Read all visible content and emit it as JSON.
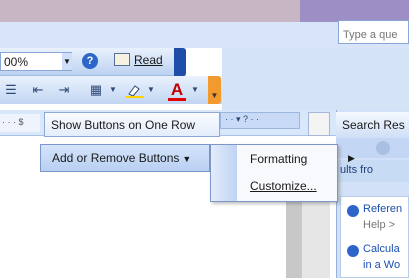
{
  "window": {
    "help_search_placeholder": "Type a que"
  },
  "standard_toolbar": {
    "zoom_value": "00%",
    "read_label": "Read"
  },
  "toolbar_options": {
    "show_buttons_one_row": "Show Buttons on One Row",
    "add_remove_buttons": "Add or Remove Buttons"
  },
  "submenu": {
    "items": [
      {
        "label": "Formatting"
      },
      {
        "label": "Customize..."
      }
    ]
  },
  "task_pane": {
    "title": "Search Res",
    "results_header": "ults fro",
    "results": [
      {
        "title": "Referen",
        "subtitle": "Help >"
      },
      {
        "title": "Calcula",
        "subtitle": "in a Wo"
      }
    ]
  },
  "colors": {
    "highlight": "#ffd400",
    "font_color": "#e00000",
    "accent": "#2d66c8"
  },
  "icons": [
    "bullets-icon",
    "decrease-indent-icon",
    "increase-indent-icon",
    "borders-icon",
    "highlight-icon",
    "font-color-icon",
    "toolbar-options-icon"
  ]
}
